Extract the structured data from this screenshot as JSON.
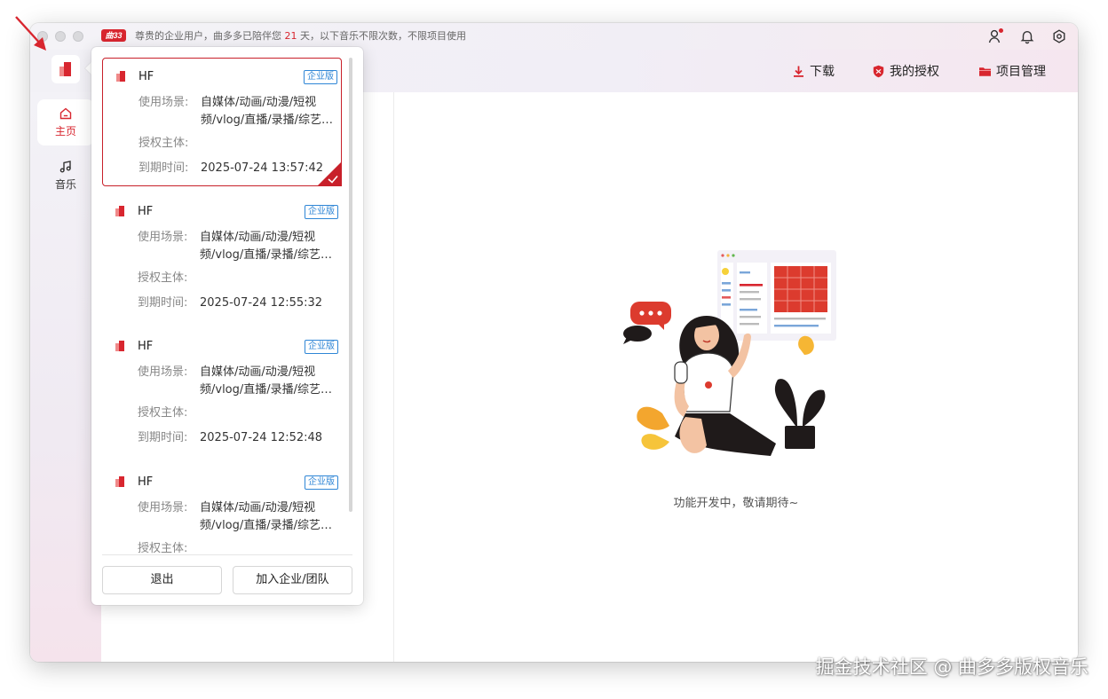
{
  "titlebar": {
    "brand_badge": "曲33",
    "notice_prefix": "尊贵的企业用户，曲多多已陪伴您 ",
    "notice_days": "21",
    "notice_suffix": " 天，以下音乐不限次数，不限项目使用",
    "accent": "#d8262f"
  },
  "header": {
    "download_label": "下载",
    "my_auth_label": "我的授权",
    "project_label": "项目管理"
  },
  "sidebar": {
    "items": [
      {
        "label": "主页",
        "icon": "home-icon"
      },
      {
        "label": "音乐",
        "icon": "music-note-icon"
      }
    ]
  },
  "popup": {
    "cards": [
      {
        "name": "HF",
        "badge": "企业版",
        "scene_label": "使用场景:",
        "scene_value": "自媒体/动画/动漫/短视频/vlog/直播/录播/综艺/广告",
        "subject_label": "授权主体:",
        "subject_value": "",
        "expire_label": "到期时间:",
        "expire_value": "2025-07-24 13:57:42"
      },
      {
        "name": "HF",
        "badge": "企业版",
        "scene_label": "使用场景:",
        "scene_value": "自媒体/动画/动漫/短视频/vlog/直播/录播/综艺/广告",
        "subject_label": "授权主体:",
        "subject_value": "",
        "expire_label": "到期时间:",
        "expire_value": "2025-07-24 12:55:32"
      },
      {
        "name": "HF",
        "badge": "企业版",
        "scene_label": "使用场景:",
        "scene_value": "自媒体/动画/动漫/短视频/vlog/直播/录播/综艺/广告",
        "subject_label": "授权主体:",
        "subject_value": "",
        "expire_label": "到期时间:",
        "expire_value": "2025-07-24 12:52:48"
      },
      {
        "name": "HF",
        "badge": "企业版",
        "scene_label": "使用场景:",
        "scene_value": "自媒体/动画/动漫/短视频/vlog/直播/录播/综艺/广告",
        "subject_label": "授权主体:",
        "subject_value": ""
      }
    ],
    "logout_label": "退出",
    "join_label": "加入企业/团队"
  },
  "main": {
    "dev_text": "功能开发中，敬请期待~"
  },
  "watermark": "掘金技术社区 @ 曲多多版权音乐"
}
